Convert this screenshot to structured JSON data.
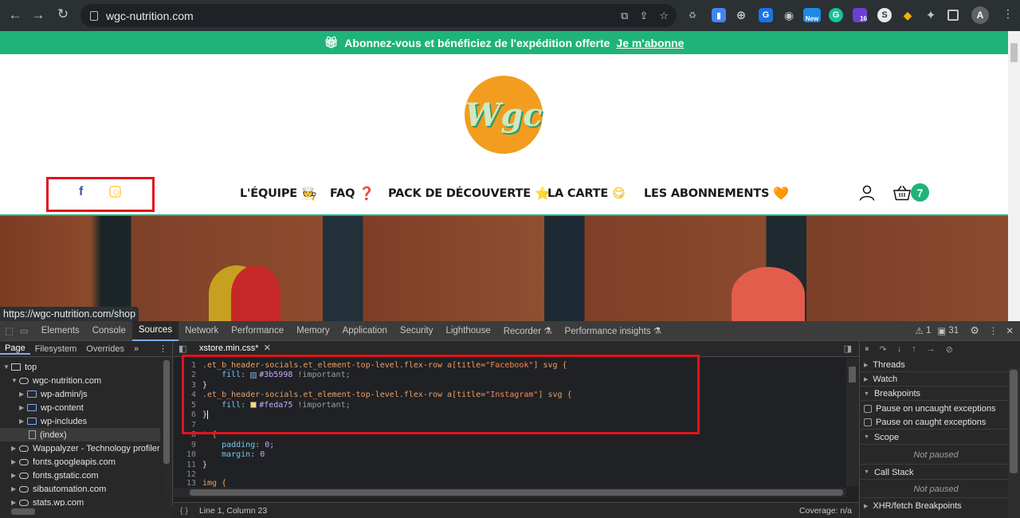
{
  "browser": {
    "url": "wgc-nutrition.com",
    "status_url": "https://wgc-nutrition.com/shop",
    "avatar_letter": "A",
    "ext_new": "New",
    "ext_badge": "16"
  },
  "site": {
    "banner_text": "Abonnez-vous et bénéficiez de l'expédition offerte",
    "banner_link": "Je m'abonne",
    "logo_text": "Wgc",
    "socials": {
      "facebook": "f"
    },
    "menu": [
      {
        "label": "L'ÉQUIPE",
        "emoji": "🧑‍🍳"
      },
      {
        "label": "FAQ",
        "emoji": "❓"
      },
      {
        "label": "PACK DE DÉCOUVERTE",
        "emoji": "⭐"
      },
      {
        "label": "LA CARTE",
        "emoji": "😋"
      },
      {
        "label": "LES ABONNEMENTS",
        "emoji": "🧡"
      }
    ],
    "cart_count": "7"
  },
  "devtools": {
    "tabs": [
      "Elements",
      "Console",
      "Sources",
      "Network",
      "Performance",
      "Memory",
      "Application",
      "Security",
      "Lighthouse",
      "Recorder ⚗",
      "Performance insights ⚗"
    ],
    "active_tab": "Sources",
    "warnings": "1",
    "errors": "31",
    "left_tabs": [
      "Page",
      "Filesystem",
      "Overrides",
      "»"
    ],
    "tree": [
      {
        "label": "top",
        "depth": 0,
        "kind": "frame"
      },
      {
        "label": "wgc-nutrition.com",
        "depth": 1,
        "kind": "cloud"
      },
      {
        "label": "wp-admin/js",
        "depth": 2,
        "kind": "folder"
      },
      {
        "label": "wp-content",
        "depth": 2,
        "kind": "folder"
      },
      {
        "label": "wp-includes",
        "depth": 2,
        "kind": "folder"
      },
      {
        "label": "(index)",
        "depth": 3,
        "kind": "file"
      },
      {
        "label": "Wappalyzer - Technology profiler",
        "depth": 1,
        "kind": "cloud"
      },
      {
        "label": "fonts.googleapis.com",
        "depth": 1,
        "kind": "cloud"
      },
      {
        "label": "fonts.gstatic.com",
        "depth": 1,
        "kind": "cloud"
      },
      {
        "label": "sibautomation.com",
        "depth": 1,
        "kind": "cloud"
      },
      {
        "label": "stats.wp.com",
        "depth": 1,
        "kind": "cloud"
      }
    ],
    "editor_tab": "xstore.min.css*",
    "code": {
      "l1_sel": ".et_b_header-socials.et_element-top-level.flex-row a[title=",
      "l1_str": "\"Facebook\"",
      "l1_end": "] svg {",
      "l2_prop": "    fill:",
      "l2_val": "#3b5998",
      "l2_imp": " !important;",
      "l3": "}",
      "l4_sel": ".et_b_header-socials.et_element-top-level.flex-row a[title=",
      "l4_str": "\"Instagram\"",
      "l4_end": "] svg {",
      "l5_prop": "    fill:",
      "l5_val": "#feda75",
      "l5_imp": " !important;",
      "l6": "}",
      "l7": "",
      "l8": "* {",
      "l9_prop": "    padding:",
      "l9_val": " 0;",
      "l10_prop": "    margin:",
      "l10_val": " 0",
      "l11": "}",
      "l12": "",
      "l13": "img {"
    },
    "line_numbers": [
      "1",
      "2",
      "3",
      "4",
      "5",
      "6",
      "7",
      "8",
      "9",
      "10",
      "11",
      "12",
      "13"
    ],
    "status_position": "Line 1, Column 23",
    "coverage": "Coverage: n/a",
    "right": {
      "threads": "Threads",
      "watch": "Watch",
      "breakpoints": "Breakpoints",
      "pause_uncaught": "Pause on uncaught exceptions",
      "pause_caught": "Pause on caught exceptions",
      "scope": "Scope",
      "scope_status": "Not paused",
      "callstack": "Call Stack",
      "callstack_status": "Not paused",
      "xhr": "XHR/fetch Breakpoints"
    }
  },
  "colors": {
    "facebook": "#3b5998",
    "instagram": "#feda75",
    "brand_green": "#1fb37a",
    "highlight": "#e0131d"
  }
}
